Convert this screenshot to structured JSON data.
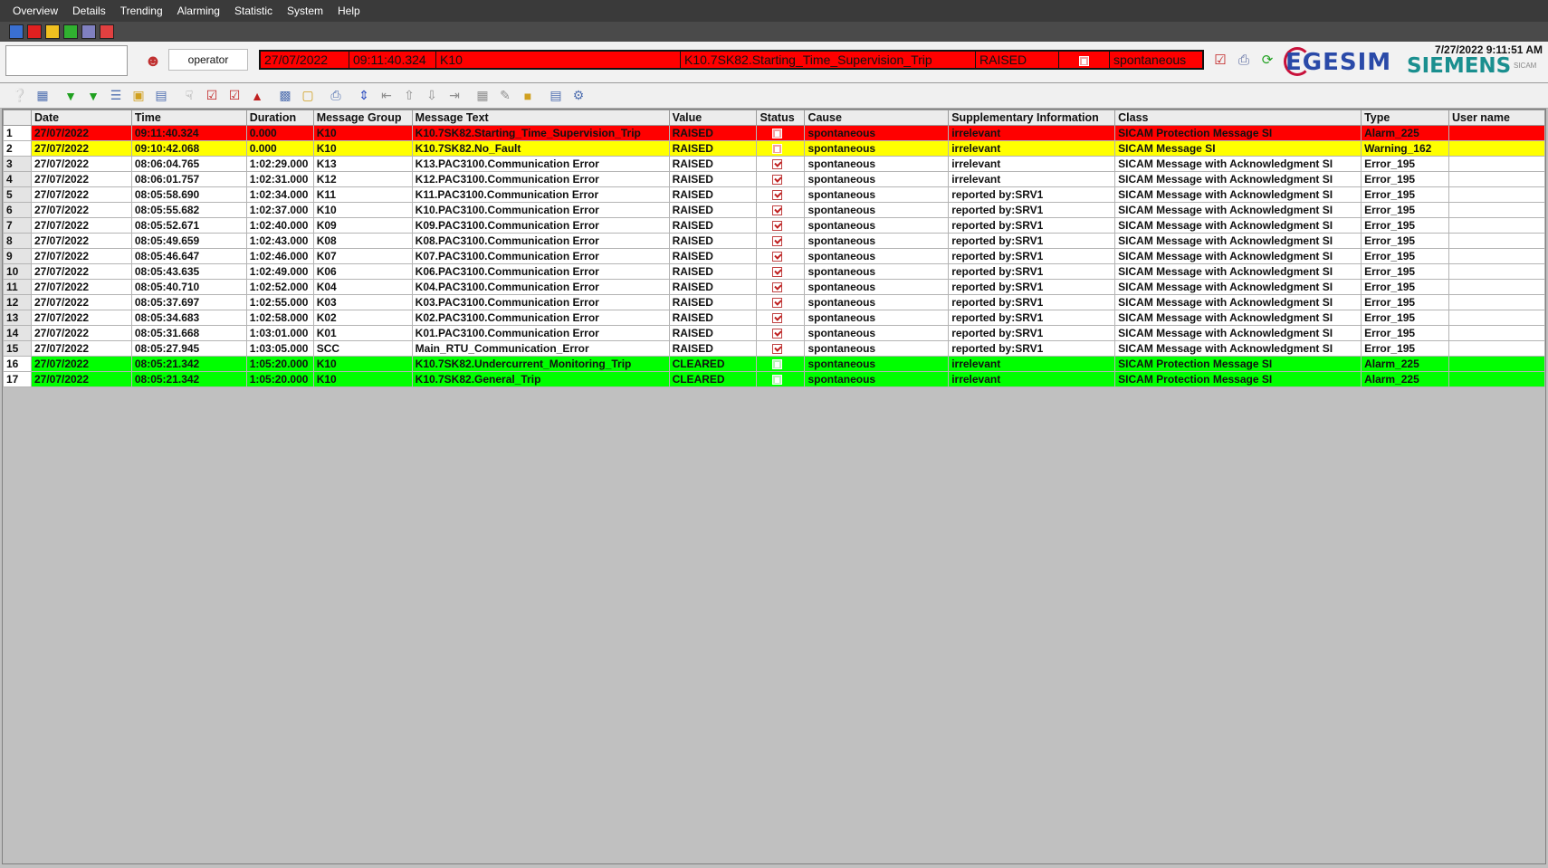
{
  "menu": [
    "Overview",
    "Details",
    "Trending",
    "Alarming",
    "Statistic",
    "System",
    "Help"
  ],
  "header": {
    "user": "operator",
    "alarm": {
      "date": "27/07/2022",
      "time": "09:11:40.324",
      "group": "K10",
      "text": "K10.7SK82.Starting_Time_Supervision_Trip",
      "value": "RAISED",
      "cause": "spontaneous"
    },
    "clock": "7/27/2022 9:11:51 AM",
    "brand_left": "EGESIM",
    "brand_right": "SIEMENS",
    "brand_small": "SICAM"
  },
  "table": {
    "columns": [
      "",
      "Date",
      "Time",
      "Duration",
      "Message Group",
      "Message Text",
      "Value",
      "Status",
      "Cause",
      "Supplementary Information",
      "Class",
      "Type",
      "User name"
    ],
    "rows": [
      {
        "n": "1",
        "date": "27/07/2022",
        "time": "09:11:40.324",
        "duration": "0.000",
        "group": "K10",
        "text": "K10.7SK82.Starting_Time_Supervision_Trip",
        "value": "RAISED",
        "status": "alarm",
        "cause": "spontaneous",
        "supp": "irrelevant",
        "cls": "SICAM Protection Message SI",
        "type": "Alarm_225",
        "user": "",
        "color": "red"
      },
      {
        "n": "2",
        "date": "27/07/2022",
        "time": "09:10:42.068",
        "duration": "0.000",
        "group": "K10",
        "text": "K10.7SK82.No_Fault",
        "value": "RAISED",
        "status": "alarm",
        "cause": "spontaneous",
        "supp": "irrelevant",
        "cls": "SICAM Message SI",
        "type": "Warning_162",
        "user": "",
        "color": "yellow"
      },
      {
        "n": "3",
        "date": "27/07/2022",
        "time": "08:06:04.765",
        "duration": "1:02:29.000",
        "group": "K13",
        "text": "K13.PAC3100.Communication Error",
        "value": "RAISED",
        "status": "ack",
        "cause": "spontaneous",
        "supp": "irrelevant",
        "cls": "SICAM Message with Acknowledgment SI",
        "type": "Error_195",
        "user": "",
        "color": "white"
      },
      {
        "n": "4",
        "date": "27/07/2022",
        "time": "08:06:01.757",
        "duration": "1:02:31.000",
        "group": "K12",
        "text": "K12.PAC3100.Communication Error",
        "value": "RAISED",
        "status": "ack",
        "cause": "spontaneous",
        "supp": "irrelevant",
        "cls": "SICAM Message with Acknowledgment SI",
        "type": "Error_195",
        "user": "",
        "color": "white"
      },
      {
        "n": "5",
        "date": "27/07/2022",
        "time": "08:05:58.690",
        "duration": "1:02:34.000",
        "group": "K11",
        "text": "K11.PAC3100.Communication Error",
        "value": "RAISED",
        "status": "ack",
        "cause": "spontaneous",
        "supp": "reported by:SRV1",
        "cls": "SICAM Message with Acknowledgment SI",
        "type": "Error_195",
        "user": "",
        "color": "white"
      },
      {
        "n": "6",
        "date": "27/07/2022",
        "time": "08:05:55.682",
        "duration": "1:02:37.000",
        "group": "K10",
        "text": "K10.PAC3100.Communication Error",
        "value": "RAISED",
        "status": "ack",
        "cause": "spontaneous",
        "supp": "reported by:SRV1",
        "cls": "SICAM Message with Acknowledgment SI",
        "type": "Error_195",
        "user": "",
        "color": "white"
      },
      {
        "n": "7",
        "date": "27/07/2022",
        "time": "08:05:52.671",
        "duration": "1:02:40.000",
        "group": "K09",
        "text": "K09.PAC3100.Communication Error",
        "value": "RAISED",
        "status": "ack",
        "cause": "spontaneous",
        "supp": "reported by:SRV1",
        "cls": "SICAM Message with Acknowledgment SI",
        "type": "Error_195",
        "user": "",
        "color": "white"
      },
      {
        "n": "8",
        "date": "27/07/2022",
        "time": "08:05:49.659",
        "duration": "1:02:43.000",
        "group": "K08",
        "text": "K08.PAC3100.Communication Error",
        "value": "RAISED",
        "status": "ack",
        "cause": "spontaneous",
        "supp": "reported by:SRV1",
        "cls": "SICAM Message with Acknowledgment SI",
        "type": "Error_195",
        "user": "",
        "color": "white"
      },
      {
        "n": "9",
        "date": "27/07/2022",
        "time": "08:05:46.647",
        "duration": "1:02:46.000",
        "group": "K07",
        "text": "K07.PAC3100.Communication Error",
        "value": "RAISED",
        "status": "ack",
        "cause": "spontaneous",
        "supp": "reported by:SRV1",
        "cls": "SICAM Message with Acknowledgment SI",
        "type": "Error_195",
        "user": "",
        "color": "white"
      },
      {
        "n": "10",
        "date": "27/07/2022",
        "time": "08:05:43.635",
        "duration": "1:02:49.000",
        "group": "K06",
        "text": "K06.PAC3100.Communication Error",
        "value": "RAISED",
        "status": "ack",
        "cause": "spontaneous",
        "supp": "reported by:SRV1",
        "cls": "SICAM Message with Acknowledgment SI",
        "type": "Error_195",
        "user": "",
        "color": "white"
      },
      {
        "n": "11",
        "date": "27/07/2022",
        "time": "08:05:40.710",
        "duration": "1:02:52.000",
        "group": "K04",
        "text": "K04.PAC3100.Communication Error",
        "value": "RAISED",
        "status": "ack",
        "cause": "spontaneous",
        "supp": "reported by:SRV1",
        "cls": "SICAM Message with Acknowledgment SI",
        "type": "Error_195",
        "user": "",
        "color": "white"
      },
      {
        "n": "12",
        "date": "27/07/2022",
        "time": "08:05:37.697",
        "duration": "1:02:55.000",
        "group": "K03",
        "text": "K03.PAC3100.Communication Error",
        "value": "RAISED",
        "status": "ack",
        "cause": "spontaneous",
        "supp": "reported by:SRV1",
        "cls": "SICAM Message with Acknowledgment SI",
        "type": "Error_195",
        "user": "",
        "color": "white"
      },
      {
        "n": "13",
        "date": "27/07/2022",
        "time": "08:05:34.683",
        "duration": "1:02:58.000",
        "group": "K02",
        "text": "K02.PAC3100.Communication Error",
        "value": "RAISED",
        "status": "ack",
        "cause": "spontaneous",
        "supp": "reported by:SRV1",
        "cls": "SICAM Message with Acknowledgment SI",
        "type": "Error_195",
        "user": "",
        "color": "white"
      },
      {
        "n": "14",
        "date": "27/07/2022",
        "time": "08:05:31.668",
        "duration": "1:03:01.000",
        "group": "K01",
        "text": "K01.PAC3100.Communication Error",
        "value": "RAISED",
        "status": "ack",
        "cause": "spontaneous",
        "supp": "reported by:SRV1",
        "cls": "SICAM Message with Acknowledgment SI",
        "type": "Error_195",
        "user": "",
        "color": "white"
      },
      {
        "n": "15",
        "date": "27/07/2022",
        "time": "08:05:27.945",
        "duration": "1:03:05.000",
        "group": "SCC",
        "text": "Main_RTU_Communication_Error",
        "value": "RAISED",
        "status": "ack",
        "cause": "spontaneous",
        "supp": "reported by:SRV1",
        "cls": "SICAM Message with Acknowledgment SI",
        "type": "Error_195",
        "user": "",
        "color": "white"
      },
      {
        "n": "16",
        "date": "27/07/2022",
        "time": "08:05:21.342",
        "duration": "1:05:20.000",
        "group": "K10",
        "text": "K10.7SK82.Undercurrent_Monitoring_Trip",
        "value": "CLEARED",
        "status": "cleared",
        "cause": "spontaneous",
        "supp": "irrelevant",
        "cls": "SICAM Protection Message SI",
        "type": "Alarm_225",
        "user": "",
        "color": "green"
      },
      {
        "n": "17",
        "date": "27/07/2022",
        "time": "08:05:21.342",
        "duration": "1:05:20.000",
        "group": "K10",
        "text": "K10.7SK82.General_Trip",
        "value": "CLEARED",
        "status": "cleared",
        "cause": "spontaneous",
        "supp": "irrelevant",
        "cls": "SICAM Protection Message SI",
        "type": "Alarm_225",
        "user": "",
        "color": "green"
      }
    ]
  },
  "colors": {
    "raised_red": "#ff0000",
    "warning_yellow": "#ffff00",
    "cleared_green": "#00ff00",
    "grid_bg": "#c0c0c0",
    "menubar": "#3a3a3a"
  }
}
